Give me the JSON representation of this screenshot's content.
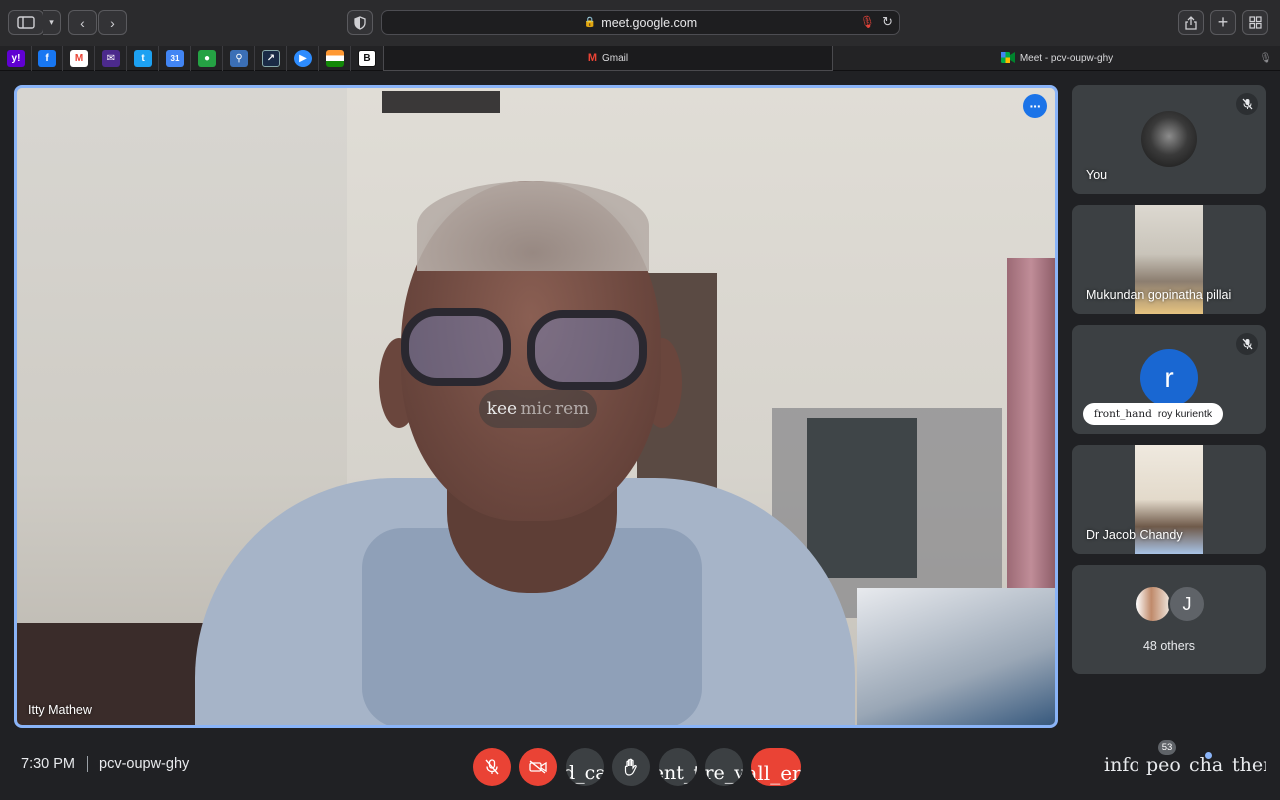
{
  "browser": {
    "url": "meet.google.com",
    "tabs": [
      {
        "label": "Gmail",
        "icon": "gmail-icon"
      },
      {
        "label": "Meet - pcv-oupw-ghy",
        "icon": "meet-icon"
      }
    ],
    "bookmarks": [
      "yahoo-icon",
      "facebook-icon",
      "gmail-icon",
      "mail-icon",
      "twitter-icon",
      "calendar-icon",
      "whatsapp-icon",
      "maps-icon",
      "news-icon",
      "zoom-icon",
      "india-flag-icon",
      "b-icon"
    ]
  },
  "main": {
    "speaker_name": "Itty Mathew",
    "caption_words": [
      "kee",
      "mic",
      "rem"
    ]
  },
  "participants": [
    {
      "name": "You",
      "muted": true,
      "type": "photo"
    },
    {
      "name": "Mukundan gopinatha pillai",
      "muted": false,
      "type": "camera"
    },
    {
      "name": "roy kurientk",
      "muted": true,
      "type": "letter",
      "letter": "r",
      "raised_hand_text": "front_hand"
    },
    {
      "name": "Dr Jacob Chandy",
      "muted": false,
      "type": "camera"
    }
  ],
  "others": {
    "label": "48 others",
    "letter": "J"
  },
  "bottom_bar": {
    "time": "7:30 PM",
    "meeting_code": "pcv-oupw-ghy",
    "controls": {
      "captions": "closed_caption",
      "present": "present_to_all",
      "more": "more_vert",
      "call_end": "call_end"
    },
    "right": {
      "info": "info",
      "people": "people",
      "chat": "chat",
      "activities": "theme"
    },
    "people_count": "53"
  },
  "colors": {
    "accent": "#8ab4f8",
    "danger": "#ea4335",
    "surface": "#3c4043",
    "background": "#202124"
  }
}
